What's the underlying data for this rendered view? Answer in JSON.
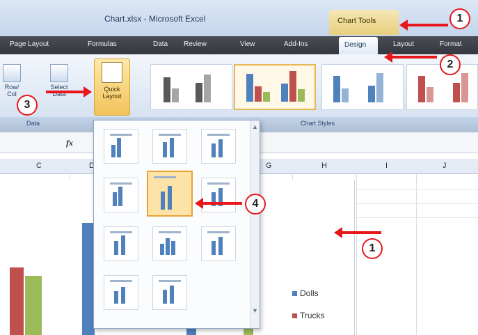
{
  "window": {
    "title": "Chart.xlsx - Microsoft Excel",
    "context_tab": "Chart Tools"
  },
  "ribbon_tabs": [
    {
      "label": "Page Layout"
    },
    {
      "label": "Formulas"
    },
    {
      "label": "Data"
    },
    {
      "label": "Review"
    },
    {
      "label": "View"
    },
    {
      "label": "Add-Ins"
    },
    {
      "label": "Design"
    },
    {
      "label": "Layout"
    },
    {
      "label": "Format"
    }
  ],
  "ribbon": {
    "select_data_label": "Select Data",
    "switch_label": "Row/ Col",
    "quick_layout_label": "Quick Layout",
    "data_group_label": "Data",
    "chart_styles_group_label": "Chart Styles"
  },
  "formula_bar": {
    "fx_label": "fx"
  },
  "columns": [
    "C",
    "D",
    "G",
    "H",
    "I",
    "J"
  ],
  "legend": [
    {
      "label": "Dolls",
      "color": "#4f81bd"
    },
    {
      "label": "Trucks",
      "color": "#c0504d"
    }
  ],
  "callouts": [
    "1",
    "2",
    "3",
    "4",
    "1"
  ],
  "colors": {
    "accent_red": "#e8171c",
    "series_blue": "#4f81bd",
    "series_red": "#c0504d",
    "series_green": "#9bbb59"
  }
}
